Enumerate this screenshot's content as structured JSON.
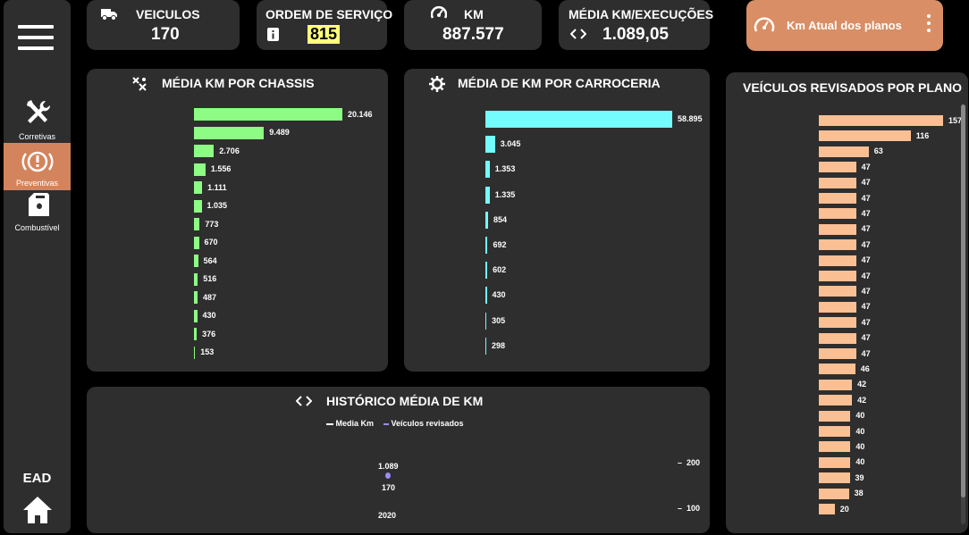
{
  "sidebar": {
    "items": [
      {
        "label": "Corretivas",
        "icon": "wrench-screwdriver-icon"
      },
      {
        "label": "Preventivas",
        "icon": "brake-warning-icon"
      },
      {
        "label": "Combustível",
        "icon": "fuel-can-icon"
      }
    ],
    "ead": "EAD"
  },
  "kpis": {
    "veiculos": {
      "label": "VEICULOS",
      "value": "170"
    },
    "ordem": {
      "label": "ORDEM DE SERVIÇO",
      "value": "815"
    },
    "km": {
      "label": "KM",
      "value": "887.577"
    },
    "media": {
      "label": "MÉDIA KM/EXECUÇÕES",
      "value": "1.089,05"
    }
  },
  "button": {
    "label": "Km Atual dos planos"
  },
  "colors": {
    "chassis": "#8cfc84",
    "carroceria": "#73fbfd",
    "plano": "#fbbf94",
    "accent": "#d98e65",
    "panel": "#2e2e2e",
    "highlight": "#ffff7a"
  },
  "chart_data": [
    {
      "type": "bar",
      "orientation": "horizontal",
      "title": "MÉDIA KM POR CHASSIS",
      "values": [
        20146,
        9489,
        2706,
        1556,
        1111,
        1035,
        773,
        670,
        564,
        516,
        487,
        430,
        376,
        153
      ],
      "labels": [
        "20.146",
        "9.489",
        "2.706",
        "1.556",
        "1.111",
        "1.035",
        "773",
        "670",
        "564",
        "516",
        "487",
        "430",
        "376",
        "153"
      ]
    },
    {
      "type": "bar",
      "orientation": "horizontal",
      "title": "MÉDIA DE KM POR CARROCERIA",
      "values": [
        58895,
        3045,
        1353,
        1335,
        854,
        692,
        602,
        430,
        305,
        298
      ],
      "labels": [
        "58.895",
        "3.045",
        "1.353",
        "1.335",
        "854",
        "692",
        "602",
        "430",
        "305",
        "298"
      ]
    },
    {
      "type": "bar",
      "orientation": "horizontal",
      "title": "VEÍCULOS REVISADOS POR PLANO",
      "values": [
        157,
        116,
        63,
        47,
        47,
        47,
        47,
        47,
        47,
        47,
        47,
        47,
        47,
        47,
        47,
        47,
        46,
        42,
        42,
        40,
        40,
        40,
        40,
        39,
        38,
        20
      ],
      "labels": [
        "157",
        "116",
        "63",
        "47",
        "47",
        "47",
        "47",
        "47",
        "47",
        "47",
        "47",
        "47",
        "47",
        "47",
        "47",
        "47",
        "46",
        "42",
        "42",
        "40",
        "40",
        "40",
        "40",
        "39",
        "38",
        "20"
      ]
    },
    {
      "type": "line",
      "title": "HISTÓRICO MÉDIA DE KM",
      "x": [
        "2020"
      ],
      "series": [
        {
          "name": "Media Km",
          "values": [
            1089
          ],
          "label": "1.089"
        },
        {
          "name": "Veículos revisados",
          "values": [
            170
          ],
          "label": "170"
        }
      ],
      "y2_ticks": [
        "200",
        "100"
      ]
    }
  ]
}
